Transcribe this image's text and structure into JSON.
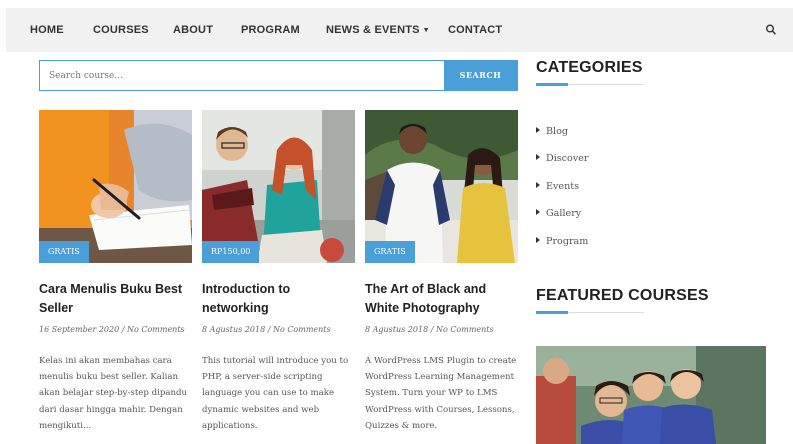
{
  "nav": {
    "items": [
      {
        "label": "HOME"
      },
      {
        "label": "COURSES"
      },
      {
        "label": "ABOUT"
      },
      {
        "label": "PROGRAM"
      },
      {
        "label": "NEWS & EVENTS"
      },
      {
        "label": "CONTACT"
      }
    ],
    "search_icon": "search-icon",
    "dropdown_icon": "caret-down-icon"
  },
  "search": {
    "placeholder": "Search course...",
    "button_label": "SEARCH"
  },
  "courses": [
    {
      "badge": "GRATIS",
      "title": "Cara Menulis Buku Best Seller",
      "date": "16 September 2020",
      "comments": "No Comments",
      "excerpt": "Kelas ini akan membahas cara menulis buku best seller. Kalian akan belajar step-by-step dipandu dari dasar hingga mahir. Dengan mengikuti..."
    },
    {
      "badge": "RP150,00",
      "title": "Introduction to networking",
      "date": "8 Agustus 2018",
      "comments": "No Comments",
      "excerpt": "This tutorial will introduce you to PHP, a server-side scripting language you can use to make dynamic websites and web applications."
    },
    {
      "badge": "GRATIS",
      "title": "The Art of Black and White Photography",
      "date": "8 Agustus 2018",
      "comments": "No Comments",
      "excerpt": "A WordPress LMS Plugin to create WordPress Learning Management System. Turn your WP to LMS WordPress with Courses, Lessons, Quizzes & more."
    }
  ],
  "sidebar": {
    "categories_heading": "CATEGORIES",
    "categories": [
      "Blog",
      "Discover",
      "Events",
      "Gallery",
      "Program"
    ],
    "featured_heading": "FEATURED COURSES"
  },
  "colors": {
    "accent": "#4a9fd8",
    "nav_bg": "#f1f1f1"
  }
}
